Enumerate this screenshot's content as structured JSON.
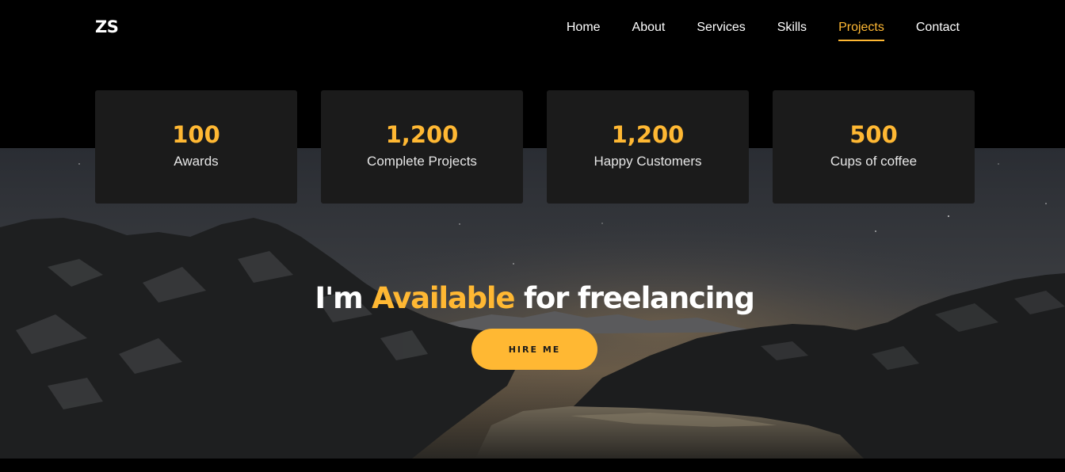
{
  "brand": {
    "logo": "ZS"
  },
  "nav": {
    "items": [
      {
        "label": "Home",
        "active": false
      },
      {
        "label": "About",
        "active": false
      },
      {
        "label": "Services",
        "active": false
      },
      {
        "label": "Skills",
        "active": false
      },
      {
        "label": "Projects",
        "active": true
      },
      {
        "label": "Contact",
        "active": false
      }
    ]
  },
  "stats": [
    {
      "value": "100",
      "label": "Awards"
    },
    {
      "value": "1,200",
      "label": "Complete Projects"
    },
    {
      "value": "1,200",
      "label": "Happy Customers"
    },
    {
      "value": "500",
      "label": "Cups of coffee"
    }
  ],
  "hero": {
    "title_prefix": "I'm ",
    "title_accent": "Available",
    "title_suffix": " for freelancing",
    "button_label": "HIRE ME"
  },
  "colors": {
    "accent": "#ffb833",
    "background": "#000000",
    "card": "#1b1b1b"
  }
}
